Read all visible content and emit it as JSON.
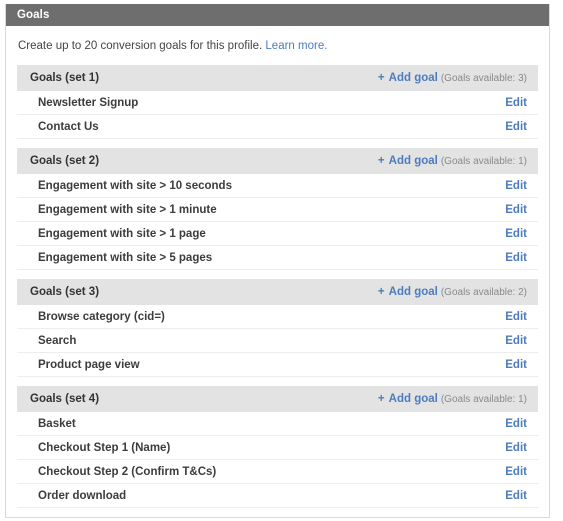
{
  "panel": {
    "title": "Goals",
    "intro_text": "Create up to 20 conversion goals for this profile.",
    "intro_link": "Learn more.",
    "add_goal_label": "Add goal",
    "add_goal_plus": "+",
    "edit_label": "Edit",
    "colors": {
      "header_bg": "#6e6e6e",
      "set_header_bg": "#e3e3e3",
      "link": "#4d7cbe",
      "muted": "#8a8a8a",
      "card_border": "#d9d9d9"
    }
  },
  "goal_sets": [
    {
      "title": "Goals (set 1)",
      "available_text": "(Goals available: 3)",
      "goals": [
        {
          "name": "Newsletter Signup"
        },
        {
          "name": "Contact Us"
        }
      ]
    },
    {
      "title": "Goals (set 2)",
      "available_text": "(Goals available: 1)",
      "goals": [
        {
          "name": "Engagement with site > 10 seconds"
        },
        {
          "name": "Engagement with site > 1 minute"
        },
        {
          "name": "Engagement with site > 1 page"
        },
        {
          "name": "Engagement with site > 5 pages"
        }
      ]
    },
    {
      "title": "Goals (set 3)",
      "available_text": "(Goals available: 2)",
      "goals": [
        {
          "name": "Browse category (cid=)"
        },
        {
          "name": "Search"
        },
        {
          "name": "Product page view"
        }
      ]
    },
    {
      "title": "Goals (set 4)",
      "available_text": "(Goals available: 1)",
      "goals": [
        {
          "name": "Basket"
        },
        {
          "name": "Checkout Step 1 (Name)"
        },
        {
          "name": "Checkout Step 2 (Confirm T&Cs)"
        },
        {
          "name": "Order download"
        }
      ]
    }
  ]
}
